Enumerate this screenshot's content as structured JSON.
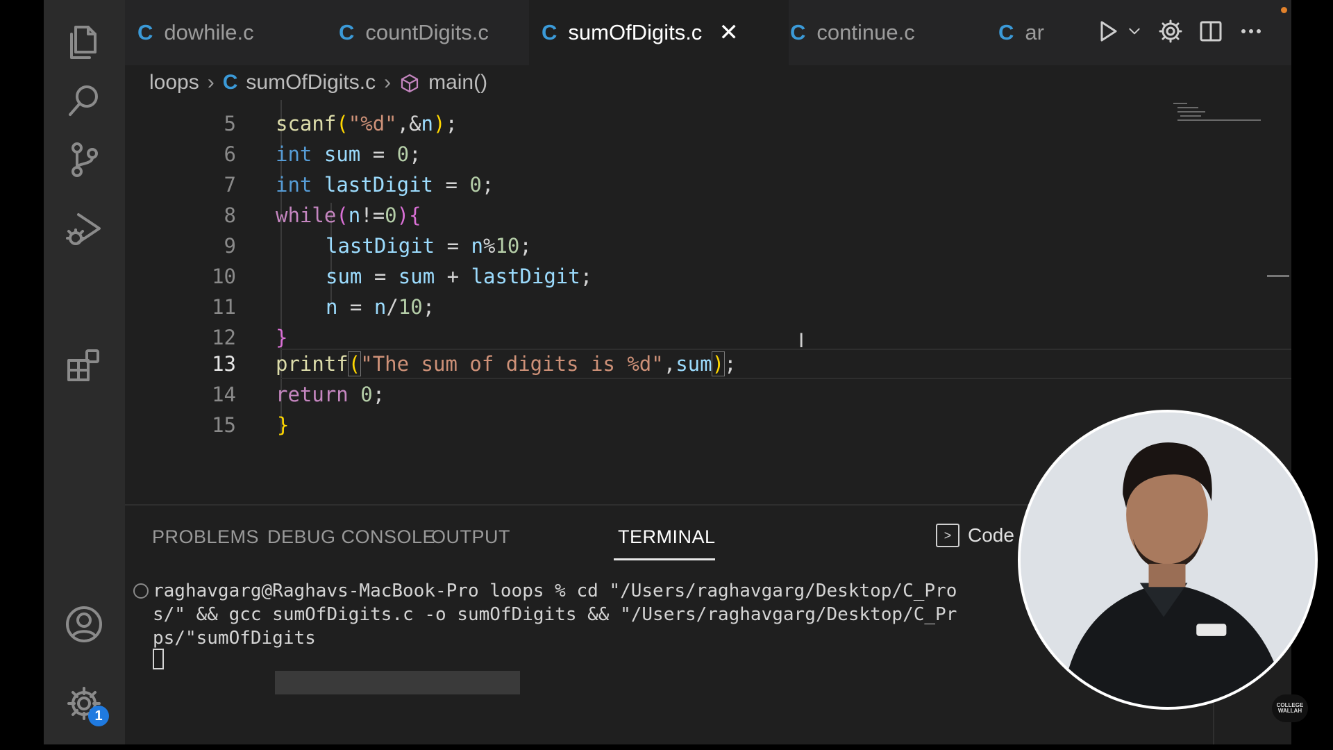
{
  "tabs": [
    {
      "icon": "C",
      "label": "dowhile.c",
      "active": false
    },
    {
      "icon": "C",
      "label": "countDigits.c",
      "active": false
    },
    {
      "icon": "C",
      "label": "sumOfDigits.c",
      "active": true,
      "close": "✕"
    },
    {
      "icon": "C",
      "label": "continue.c",
      "active": false
    },
    {
      "icon": "C",
      "label": "ar",
      "active": false
    }
  ],
  "breadcrumb": {
    "folder": "loops",
    "file_icon": "C",
    "file": "sumOfDigits.c",
    "symbol": "main()"
  },
  "code": {
    "current_line": 13,
    "lines": [
      {
        "n": "5",
        "text": "scanf(\"%d\",&n);"
      },
      {
        "n": "6",
        "text": "int sum = 0;"
      },
      {
        "n": "7",
        "text": "int lastDigit = 0;"
      },
      {
        "n": "8",
        "text": "while(n!=0){"
      },
      {
        "n": "9",
        "text": "lastDigit = n%10;"
      },
      {
        "n": "10",
        "text": "sum = sum + lastDigit;"
      },
      {
        "n": "11",
        "text": "n = n/10;"
      },
      {
        "n": "12",
        "text": "}"
      },
      {
        "n": "13",
        "text": "printf(\"The sum of digits is %d\",sum);"
      },
      {
        "n": "14",
        "text": "return 0;"
      },
      {
        "n": "15",
        "text": "}"
      }
    ]
  },
  "panel": {
    "tabs": [
      "PROBLEMS",
      "DEBUG CONSOLE",
      "OUTPUT",
      "TERMINAL"
    ],
    "active_tab": "TERMINAL",
    "terminal_title": "Code - loo",
    "terminal_lines": [
      "raghavgarg@Raghavs-MacBook-Pro loops % cd \"/Users/raghavgarg/Desktop/C_Pro",
      "s/\" && gcc sumOfDigits.c -o sumOfDigits && \"/Users/raghavgarg/Desktop/C_Pr",
      "ps/\"sumOfDigits"
    ]
  },
  "settings_badge": "1",
  "colors": {
    "accent": "#3b9ad8",
    "badge": "#1f7ae0",
    "notification_dot": "#e3822b"
  },
  "icons": [
    "explorer-icon",
    "search-icon",
    "source-control-icon",
    "run-debug-icon",
    "extensions-icon",
    "account-icon",
    "manage-gear-icon",
    "run-icon",
    "chevron-down-icon",
    "settings-gear-icon",
    "split-editor-icon",
    "more-actions-icon",
    "chevron-right-icon",
    "cube-symbol-icon"
  ],
  "watermark": "COLLEGE WALLAH"
}
